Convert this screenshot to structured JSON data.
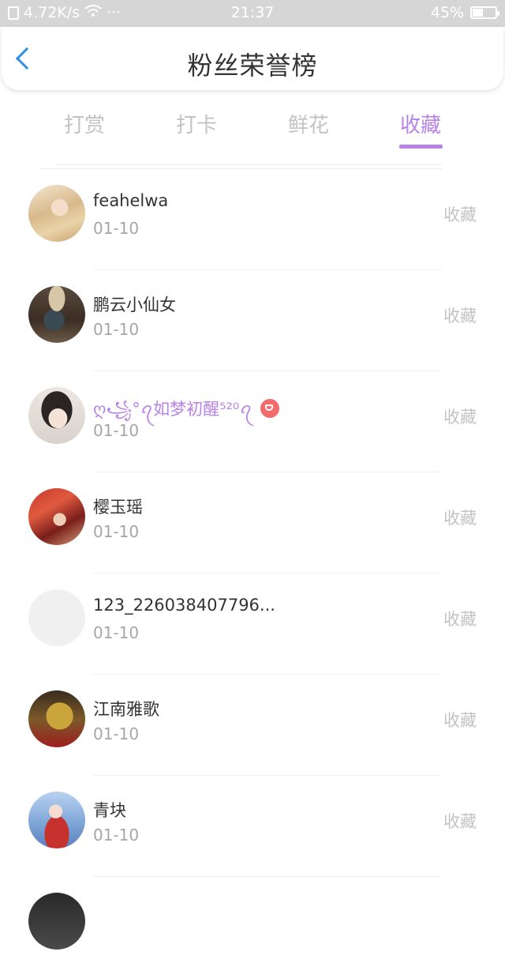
{
  "status_bar": {
    "network_speed": "4.72K/s",
    "dots": "···",
    "time": "21:37",
    "battery": "45%",
    "battery_level": 0.45
  },
  "header": {
    "title": "粉丝荣誉榜"
  },
  "tabs": [
    {
      "label": "打赏",
      "active": false
    },
    {
      "label": "打卡",
      "active": false
    },
    {
      "label": "鲜花",
      "active": false
    },
    {
      "label": "收藏",
      "active": true
    }
  ],
  "list": [
    {
      "name": "feahelwa",
      "date": "01-10",
      "action": "收藏"
    },
    {
      "name": "鹏云小仙女",
      "date": "01-10",
      "action": "收藏"
    },
    {
      "name": "ღ꧁°ꪖ如梦初醒⁵²⁰ꪖ",
      "date": "01-10",
      "action": "收藏",
      "vip": true
    },
    {
      "name": "樱玉瑶",
      "date": "01-10",
      "action": "收藏"
    },
    {
      "name": "123_226038407796...",
      "date": "01-10",
      "action": "收藏"
    },
    {
      "name": "江南雅歌",
      "date": "01-10",
      "action": "收藏"
    },
    {
      "name": "青块",
      "date": "01-10",
      "action": "收藏"
    }
  ],
  "colors": {
    "accent": "#b883e6",
    "back_arrow": "#2f8fe6",
    "vip_badge": "#f46b6b"
  }
}
